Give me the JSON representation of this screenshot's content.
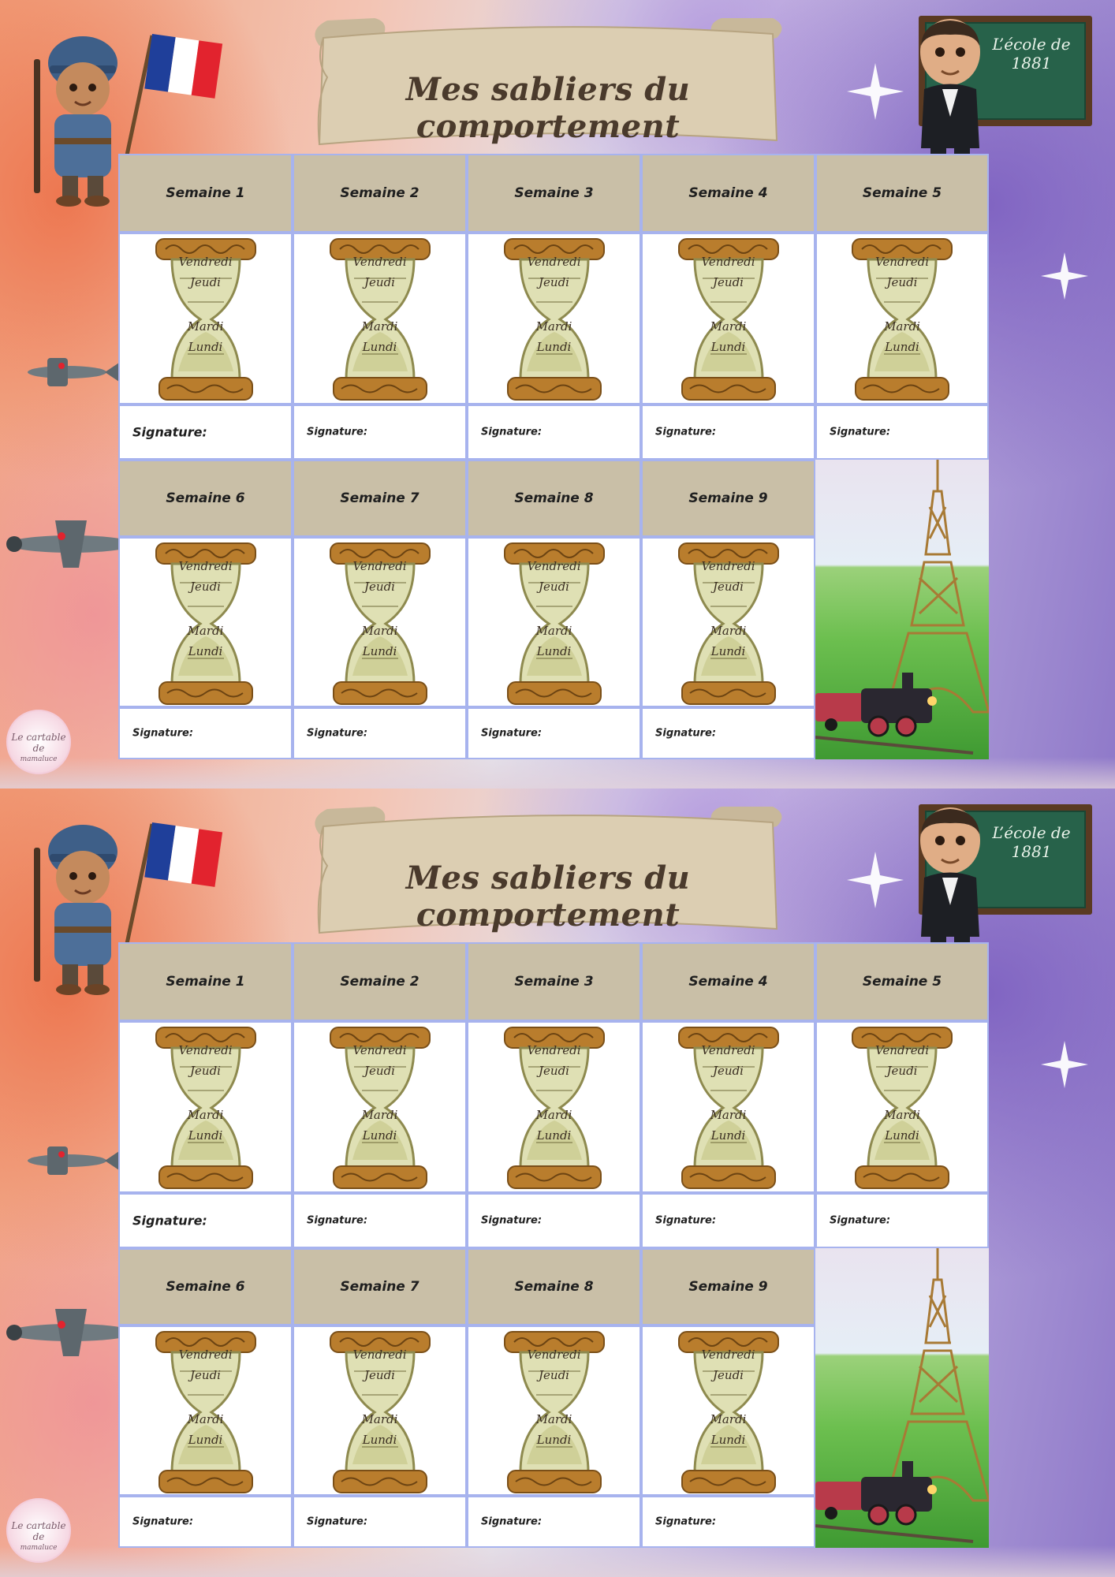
{
  "colors": {
    "header_bg": "#c9bfa7",
    "cell_border": "#a7b3ee",
    "title_text": "#4a3a2c",
    "chalkboard": "#27624a"
  },
  "sheets": [
    {
      "title": "Mes sabliers du comportement",
      "chalkboard": {
        "line1": "L’école de",
        "line2": "1881"
      },
      "logo": {
        "line1": "Le cartable de",
        "line2": "mamaluce"
      },
      "hourglass_days": [
        "Vendredi",
        "Jeudi",
        "Mardi",
        "Lundi"
      ],
      "signature_label": "Signature:",
      "weeks": [
        "Semaine 1",
        "Semaine 2",
        "Semaine 3",
        "Semaine 4",
        "Semaine 5",
        "Semaine 6",
        "Semaine 7",
        "Semaine 8",
        "Semaine 9"
      ]
    },
    {
      "title": "Mes sabliers du comportement",
      "chalkboard": {
        "line1": "L’école de",
        "line2": "1881"
      },
      "logo": {
        "line1": "Le cartable de",
        "line2": "mamaluce"
      },
      "hourglass_days": [
        "Vendredi",
        "Jeudi",
        "Mardi",
        "Lundi"
      ],
      "signature_label": "Signature:",
      "weeks": [
        "Semaine 1",
        "Semaine 2",
        "Semaine 3",
        "Semaine 4",
        "Semaine 5",
        "Semaine 6",
        "Semaine 7",
        "Semaine 8",
        "Semaine 9"
      ]
    }
  ]
}
